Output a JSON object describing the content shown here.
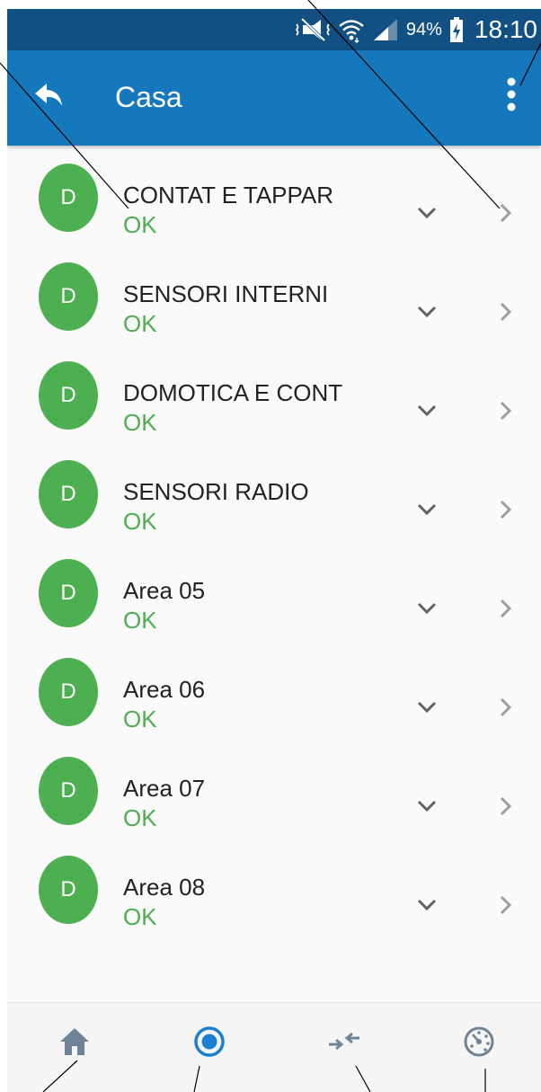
{
  "status_bar": {
    "battery_percent": "94%",
    "time": "18:10",
    "icons": [
      "vibrate-mute-icon",
      "wifi-icon",
      "signal-icon",
      "battery-charging-icon"
    ]
  },
  "app_bar": {
    "title": "Casa",
    "back_icon": "reply-arrow-icon",
    "menu_icon": "more-vert-icon"
  },
  "areas": [
    {
      "avatar": "D",
      "name": "CONTAT E TAPPAR",
      "status": "OK"
    },
    {
      "avatar": "D",
      "name": "SENSORI INTERNI",
      "status": "OK"
    },
    {
      "avatar": "D",
      "name": "DOMOTICA E CONT",
      "status": "OK"
    },
    {
      "avatar": "D",
      "name": "SENSORI RADIO",
      "status": "OK"
    },
    {
      "avatar": "D",
      "name": "Area 05",
      "status": "OK"
    },
    {
      "avatar": "D",
      "name": "Area 06",
      "status": "OK"
    },
    {
      "avatar": "D",
      "name": "Area 07",
      "status": "OK"
    },
    {
      "avatar": "D",
      "name": "Area 08",
      "status": "OK"
    }
  ],
  "bottom_nav": [
    {
      "icon": "home-icon",
      "active": false
    },
    {
      "icon": "radio-target-icon",
      "active": true
    },
    {
      "icon": "arrows-converge-icon",
      "active": false
    },
    {
      "icon": "speedometer-icon",
      "active": false
    }
  ],
  "colors": {
    "status_bar": "#124f82",
    "app_bar": "#1577bc",
    "status_ok": "#4caf50",
    "avatar": "#4caf50",
    "nav_inactive": "#6f8396",
    "nav_active": "#1a7fd0"
  }
}
